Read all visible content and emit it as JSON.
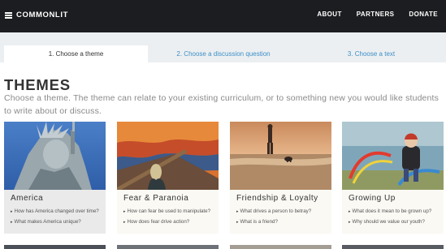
{
  "nav": {
    "logo": "COMMONLIT",
    "links": [
      "ABOUT",
      "PARTNERS",
      "DONATE"
    ]
  },
  "tabs": [
    {
      "label": "1. Choose a theme",
      "active": true
    },
    {
      "label": "2. Choose a discussion question",
      "active": false
    },
    {
      "label": "3. Choose a text",
      "active": false
    }
  ],
  "page": {
    "title": "THEMES",
    "intro": "Choose a theme. The theme can relate to your existing curriculum, or to something new you would like students to write about or discuss."
  },
  "themes": [
    {
      "title": "America",
      "questions": [
        "How has America changed over time?",
        "What makes America unique?"
      ]
    },
    {
      "title": "Fear & Paranoia",
      "questions": [
        "How can fear be used to manipulate?",
        "How does fear drive action?"
      ]
    },
    {
      "title": "Friendship & Loyalty",
      "questions": [
        "What drives a person to betray?",
        "What is a friend?"
      ]
    },
    {
      "title": "Growing Up",
      "questions": [
        "What does it mean to be grown up?",
        "Why should we value our youth?"
      ]
    }
  ],
  "colors": {
    "nav_bg": "#1c1d20",
    "link_blue": "#3d8fc8",
    "card_bg": "#faf9f4",
    "card_active_bg": "#eaeaea"
  }
}
